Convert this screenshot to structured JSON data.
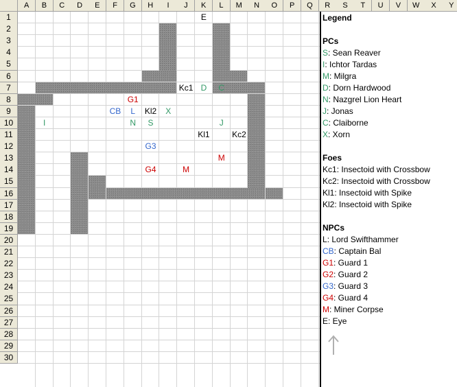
{
  "columns": [
    "A",
    "B",
    "C",
    "D",
    "E",
    "F",
    "G",
    "H",
    "I",
    "J",
    "K",
    "L",
    "M",
    "N",
    "O",
    "P",
    "Q",
    "R",
    "S",
    "T",
    "U",
    "V",
    "W",
    "X",
    "Y"
  ],
  "rows": [
    "1",
    "2",
    "3",
    "4",
    "5",
    "6",
    "7",
    "8",
    "9",
    "10",
    "11",
    "12",
    "13",
    "14",
    "15",
    "16",
    "17",
    "18",
    "19",
    "20",
    "21",
    "22",
    "23",
    "24",
    "25",
    "26",
    "27",
    "28",
    "29",
    "30"
  ],
  "colors": {
    "green": "#339966",
    "blue": "#3366cc",
    "red": "#cc0000",
    "black": "#000000",
    "header_bg": "#ece9d8",
    "wall": "#8c8c8c"
  },
  "tokens": [
    {
      "text": "E",
      "col": "K",
      "row": "1",
      "color": "black"
    },
    {
      "text": "Kc1",
      "col": "J",
      "row": "7",
      "color": "black"
    },
    {
      "text": "D",
      "col": "K",
      "row": "7",
      "color": "green"
    },
    {
      "text": "C",
      "col": "L",
      "row": "7",
      "color": "green"
    },
    {
      "text": "G1",
      "col": "G",
      "row": "8",
      "color": "red"
    },
    {
      "text": "CB",
      "col": "F",
      "row": "9",
      "color": "blue"
    },
    {
      "text": "L",
      "col": "G",
      "row": "9",
      "color": "blue"
    },
    {
      "text": "Kl2",
      "col": "H",
      "row": "9",
      "color": "black"
    },
    {
      "text": "X",
      "col": "I",
      "row": "9",
      "color": "green"
    },
    {
      "text": "I",
      "col": "B",
      "row": "10",
      "color": "green"
    },
    {
      "text": "N",
      "col": "G",
      "row": "10",
      "color": "green"
    },
    {
      "text": "S",
      "col": "H",
      "row": "10",
      "color": "green"
    },
    {
      "text": "J",
      "col": "L",
      "row": "10",
      "color": "green"
    },
    {
      "text": "Kl1",
      "col": "K",
      "row": "11",
      "color": "black"
    },
    {
      "text": "Kc2",
      "col": "M",
      "row": "11",
      "color": "black"
    },
    {
      "text": "G3",
      "col": "H",
      "row": "12",
      "color": "blue"
    },
    {
      "text": "M",
      "col": "L",
      "row": "13",
      "color": "red"
    },
    {
      "text": "G4",
      "col": "H",
      "row": "14",
      "color": "red"
    },
    {
      "text": "M",
      "col": "J",
      "row": "14",
      "color": "red"
    }
  ],
  "legend": {
    "title": "Legend",
    "pcs": {
      "heading": "PCs",
      "items": [
        {
          "key": "S",
          "desc": ": Sean Reaver",
          "color": "green"
        },
        {
          "key": "I",
          "desc": ": Ichtor Tardas",
          "color": "green"
        },
        {
          "key": "M",
          "desc": ": Milgra",
          "color": "green"
        },
        {
          "key": "D",
          "desc": ": Dorn Hardwood",
          "color": "green"
        },
        {
          "key": "N",
          "desc": ": Nazgrel Lion Heart",
          "color": "green"
        },
        {
          "key": "J",
          "desc": ": Jonas",
          "color": "green"
        },
        {
          "key": "C",
          "desc": ": Claiborne",
          "color": "green"
        },
        {
          "key": "X",
          "desc": ": Xorn",
          "color": "green"
        }
      ]
    },
    "foes": {
      "heading": "Foes",
      "items": [
        {
          "key": "Kc1",
          "desc": ": Insectoid with Crossbow",
          "color": "black"
        },
        {
          "key": "Kc2",
          "desc": ": Insectoid with Crossbow",
          "color": "black"
        },
        {
          "key": "Kl1",
          "desc": ": Insectoid with Spike",
          "color": "black"
        },
        {
          "key": "Kl2",
          "desc": ": Insectoid with Spike",
          "color": "black"
        }
      ]
    },
    "npcs": {
      "heading": "NPCs",
      "items": [
        {
          "key": "L",
          "desc": ": Lord Swifthammer",
          "color": "black"
        },
        {
          "key": "CB",
          "desc": ": Captain Bal",
          "color": "blue"
        },
        {
          "key": "G1",
          "desc": ": Guard 1",
          "color": "red"
        },
        {
          "key": "G2",
          "desc": ": Guard 2",
          "color": "red"
        },
        {
          "key": "G3",
          "desc": ": Guard 3",
          "color": "blue"
        },
        {
          "key": "G4",
          "desc": ": Guard 4",
          "color": "red"
        },
        {
          "key": "M",
          "desc": ": Miner Corpse",
          "color": "red"
        },
        {
          "key": "E",
          "desc": ": Eye",
          "color": "black"
        }
      ]
    },
    "arrow_icon": "up-arrow-icon"
  }
}
